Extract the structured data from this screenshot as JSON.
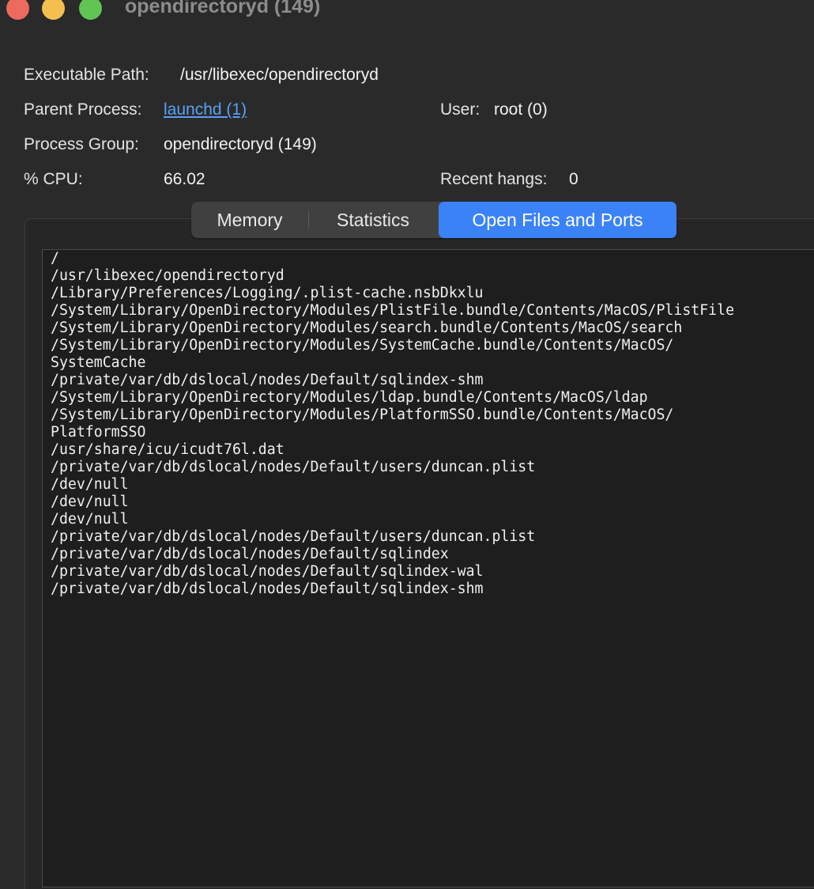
{
  "window": {
    "title": "opendirectoryd (149)"
  },
  "info": {
    "executable_path_label": "Executable Path:",
    "executable_path_value": "/usr/libexec/opendirectoryd",
    "parent_process_label": "Parent Process:",
    "parent_process_value": "launchd (1)",
    "user_label": "User:",
    "user_value": "root (0)",
    "process_group_label": "Process Group:",
    "process_group_value": "opendirectoryd (149)",
    "cpu_label": "% CPU:",
    "cpu_value": "66.02",
    "recent_hangs_label": "Recent hangs:",
    "recent_hangs_value": "0"
  },
  "tabs": {
    "items": [
      {
        "label": "Memory",
        "selected": false
      },
      {
        "label": "Statistics",
        "selected": false
      },
      {
        "label": "Open Files and Ports",
        "selected": true
      }
    ]
  },
  "open_files": [
    "/",
    "/usr/libexec/opendirectoryd",
    "/Library/Preferences/Logging/.plist-cache.nsbDkxlu",
    "/System/Library/OpenDirectory/Modules/PlistFile.bundle/Contents/MacOS/PlistFile",
    "/System/Library/OpenDirectory/Modules/search.bundle/Contents/MacOS/search",
    "/System/Library/OpenDirectory/Modules/SystemCache.bundle/Contents/MacOS/",
    "SystemCache",
    "/private/var/db/dslocal/nodes/Default/sqlindex-shm",
    "/System/Library/OpenDirectory/Modules/ldap.bundle/Contents/MacOS/ldap",
    "/System/Library/OpenDirectory/Modules/PlatformSSO.bundle/Contents/MacOS/",
    "PlatformSSO",
    "/usr/share/icu/icudt76l.dat",
    "/private/var/db/dslocal/nodes/Default/users/duncan.plist",
    "/dev/null",
    "/dev/null",
    "/dev/null",
    "/private/var/db/dslocal/nodes/Default/users/duncan.plist",
    "/private/var/db/dslocal/nodes/Default/sqlindex",
    "/private/var/db/dslocal/nodes/Default/sqlindex-wal",
    "/private/var/db/dslocal/nodes/Default/sqlindex-shm"
  ],
  "colors": {
    "accent": "#3b82f6",
    "link": "#5aa0f7",
    "close": "#ed6a5e",
    "minimize": "#f5bf4f",
    "zoom": "#61c554"
  }
}
